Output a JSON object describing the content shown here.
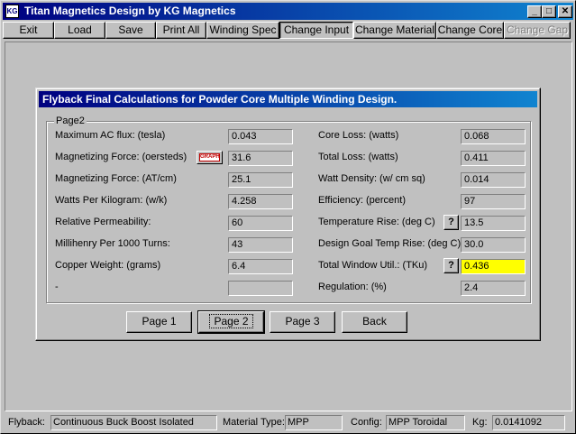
{
  "app": {
    "title": "Titan Magnetics Design by KG Magnetics",
    "icon_text": "KG",
    "controls": {
      "minimize": "_",
      "maximize": "□",
      "close": "✕"
    }
  },
  "menu": [
    {
      "label": "Exit",
      "state": "normal"
    },
    {
      "label": "Load",
      "state": "normal"
    },
    {
      "label": "Save",
      "state": "normal"
    },
    {
      "label": "Print All",
      "state": "normal"
    },
    {
      "label": "Winding Spec",
      "state": "normal"
    },
    {
      "label": "Change Input",
      "state": "pressed"
    },
    {
      "label": "Change Material",
      "state": "normal"
    },
    {
      "label": "Change Core",
      "state": "normal"
    },
    {
      "label": "Change Gap",
      "state": "disabled"
    }
  ],
  "dialog": {
    "title": "Flyback Final Calculations for Powder Core Multiple Winding Design.",
    "group_label": "Page2",
    "left": [
      {
        "label": "Maximum AC flux: (tesla)",
        "value": "0.043"
      },
      {
        "label": "Magnetizing Force: (oersteds)",
        "value": "31.6",
        "graph_button": "GRAPH"
      },
      {
        "label": "Magnetizing Force: (AT/cm)",
        "value": "25.1"
      },
      {
        "label": "Watts Per Kilogram: (w/k)",
        "value": "4.258"
      },
      {
        "label": "Relative Permeability:",
        "value": "60"
      },
      {
        "label": "Millihenry Per 1000 Turns:",
        "value": "43"
      },
      {
        "label": "Copper Weight: (grams)",
        "value": "6.4"
      },
      {
        "label": "-",
        "value": ""
      }
    ],
    "right": [
      {
        "label": "Core Loss: (watts)",
        "value": "0.068"
      },
      {
        "label": "Total Loss: (watts)",
        "value": "0.411"
      },
      {
        "label": "Watt Density: (w/ cm sq)",
        "value": "0.014"
      },
      {
        "label": "Efficiency: (percent)",
        "value": "97"
      },
      {
        "label": "Temperature Rise: (deg C)",
        "value": "13.5",
        "help": "?"
      },
      {
        "label": "Design Goal Temp Rise: (deg C)",
        "value": "30.0"
      },
      {
        "label": "Total Window Util.: (TKu)",
        "value": "0.436",
        "help": "?",
        "highlight": "#ffff00"
      },
      {
        "label": "Regulation: (%)",
        "value": "2.4"
      }
    ],
    "buttons": [
      {
        "label": "Page 1"
      },
      {
        "label": "Page 2",
        "default": true
      },
      {
        "label": "Page 3"
      },
      {
        "label": "Back"
      }
    ]
  },
  "status": {
    "flyback_label": "Flyback:",
    "flyback_value": "Continuous Buck Boost Isolated",
    "material_label": "Material Type:",
    "material_value": "MPP",
    "config_label": "Config:",
    "config_value": "MPP Toroidal",
    "kg_label": "Kg:",
    "kg_value": "0.0141092"
  },
  "colors": {
    "title_gradient_start": "#000080",
    "title_gradient_end": "#1084d0",
    "face": "#c0c0c0",
    "highlight_field": "#ffff00"
  }
}
